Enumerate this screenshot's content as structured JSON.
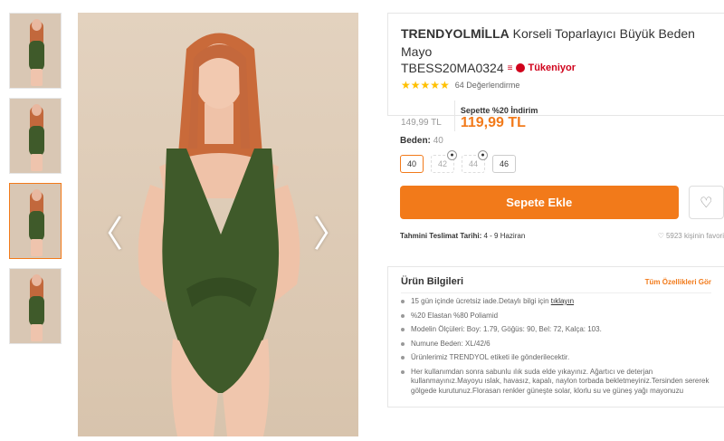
{
  "product": {
    "brand": "TRENDYOLMİLLA",
    "name": "Korseli Toparlayıcı Büyük Beden Mayo",
    "code": "TBESS20MA0324",
    "stock_icon": "≡",
    "stock_status": "Tükeniyor",
    "stars": "★★★★★",
    "review_count": "64 Değerlendirme",
    "old_price": "149,99 TL",
    "promo_label": "Sepette %20 İndirim",
    "new_price": "119,99 TL"
  },
  "gallery": {
    "prev_arrow": "〈",
    "next_arrow": "〉",
    "active_thumb_index": 2
  },
  "sizes": {
    "label": "Beden:",
    "selected": "40",
    "options": [
      {
        "label": "40",
        "state": "selected"
      },
      {
        "label": "42",
        "state": "disabled"
      },
      {
        "label": "44",
        "state": "disabled"
      },
      {
        "label": "46",
        "state": "available"
      }
    ]
  },
  "cart": {
    "add_label": "Sepete Ekle",
    "fav_icon": "♡"
  },
  "delivery": {
    "label": "Tahmini Teslimat Tarihi:",
    "value": "4 - 9 Haziran",
    "fav_icon": "♡",
    "fav_text": "5923 kişinin favori"
  },
  "info": {
    "title": "Ürün Bilgileri",
    "all_features": "Tüm Özellikleri Gör",
    "return_text": "15 gün içinde ücretsiz iade.Detaylı bilgi için ",
    "return_link": "tıklayın",
    "items": [
      "%20 Elastan %80 Poliamid",
      "Modelin Ölçüleri: Boy: 1.79, Göğüs: 90, Bel: 72, Kalça: 103.",
      "Numune Beden: XL/42/6",
      "Ürünlerimiz TRENDYOL etiketi ile gönderilecektir.",
      "Her kullanımdan sonra sabunlu ılık suda elde yıkayınız. Ağartıcı ve deterjan kullanmayınız.Mayoyu ıslak, havasız, kapalı, naylon torbada bekletmeyiniz.Tersinden sererek gölgede kurutunuz.Florasan renkler güneşte solar, klorlu su ve güneş yağı mayonuzu"
    ]
  },
  "colors": {
    "accent": "#f27a1a",
    "star": "#ffc000",
    "swimsuit": "#3f5a2a",
    "urgency": "#d0021b"
  }
}
